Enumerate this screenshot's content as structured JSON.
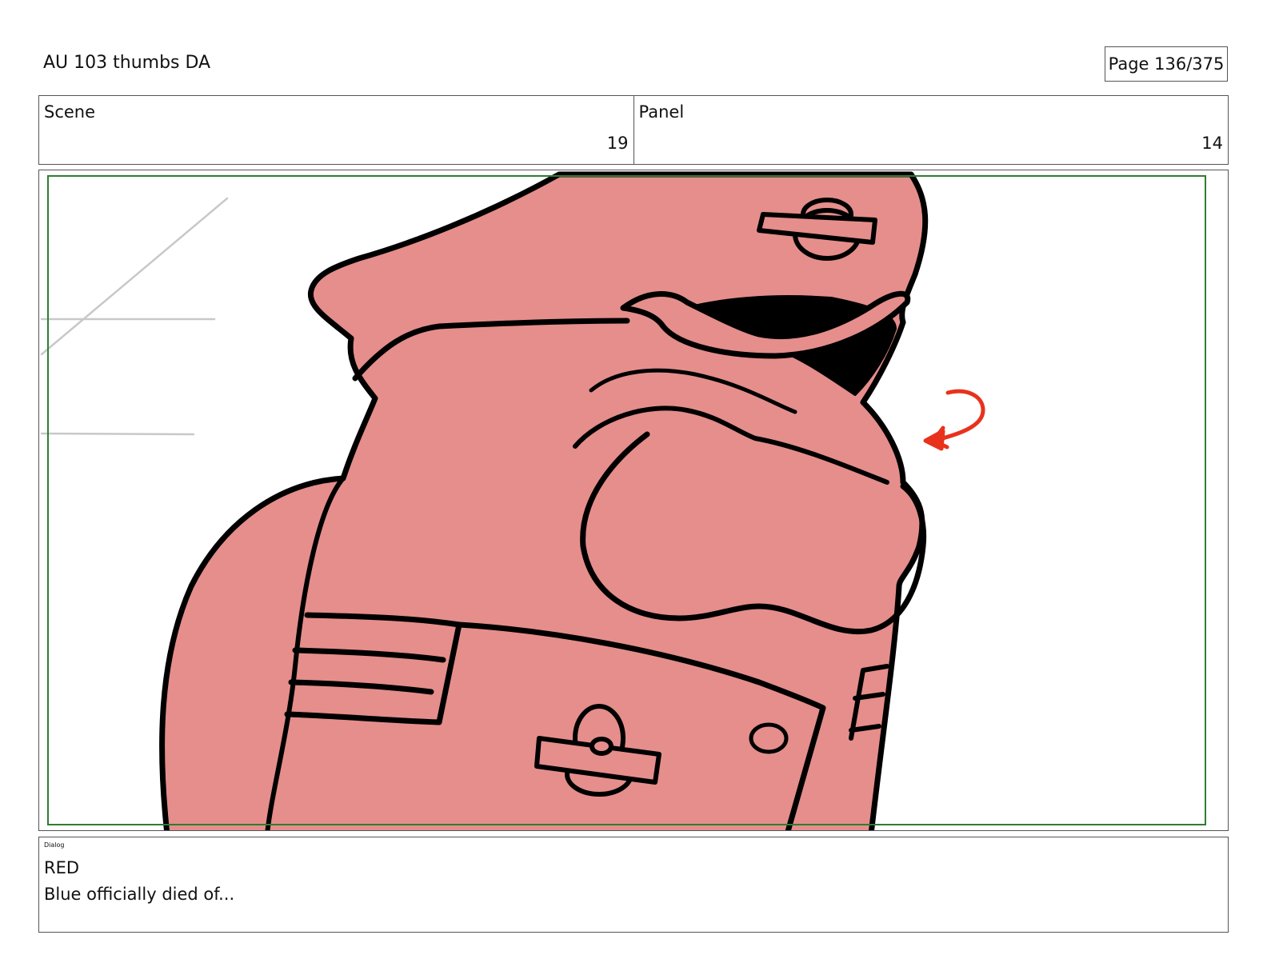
{
  "header": {
    "title": "AU 103 thumbs DA",
    "page_indicator": "Page 136/375"
  },
  "info": {
    "scene_label": "Scene",
    "scene_value": "19",
    "panel_label": "Panel",
    "panel_value": "14"
  },
  "panel_image": {
    "description_icon": "storyboard-drawing",
    "colors": {
      "character_fill": "#e58e8b",
      "outline": "#000000",
      "safe_frame": "#2e7d32",
      "arrow": "#e8321c",
      "sketch_lines": "#c8c8c8"
    }
  },
  "dialog": {
    "label": "Dialog",
    "speaker": "RED",
    "line": "Blue officially died of..."
  }
}
